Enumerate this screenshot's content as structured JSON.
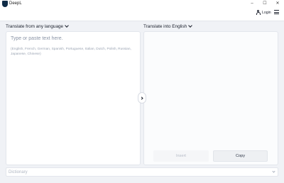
{
  "window": {
    "title": "DeepL",
    "minimize_glyph": "–",
    "maximize_glyph": "☐",
    "close_glyph": "✕"
  },
  "header": {
    "login_label": "Login"
  },
  "source": {
    "language_label": "Translate from any language",
    "placeholder": "Type or paste text here.",
    "hint": "(English, French, German, Spanish, Portuguese, Italian, Dutch, Polish, Russian, Japanese, Chinese)"
  },
  "target": {
    "language_label": "Translate into English",
    "insert_label": "Insert",
    "copy_label": "Copy"
  },
  "dictionary": {
    "label": "Dictionary"
  },
  "icons": {
    "app": "deepl-logo-icon",
    "user": "person-icon",
    "menu": "hamburger-menu-icon",
    "swap": "chevron-right-icon",
    "lang_dropdown": "chevron-down-icon"
  }
}
